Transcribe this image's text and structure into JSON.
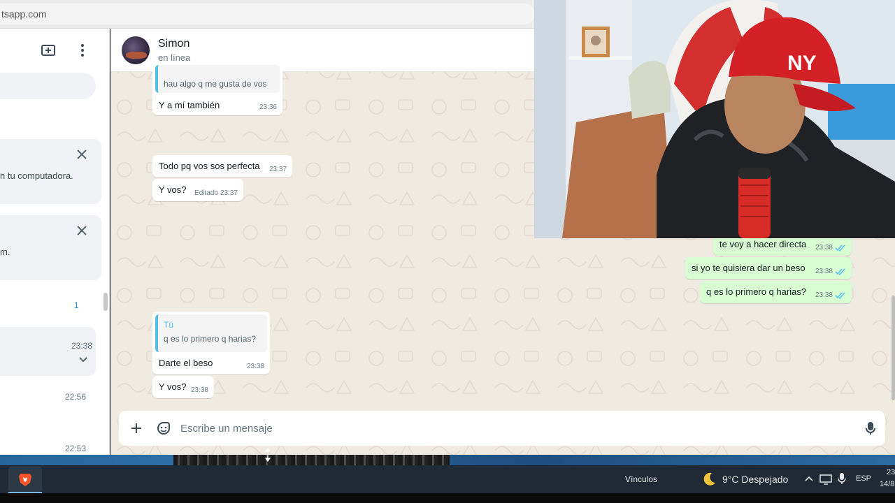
{
  "browser": {
    "url": "tsapp.com"
  },
  "sidebar": {
    "notices": [
      {
        "text": "n tu computadora."
      },
      {
        "text": "m."
      }
    ],
    "rows": [
      {
        "time": "",
        "badge": "1"
      },
      {
        "time": "23:38",
        "badge": ""
      },
      {
        "time": "22:56",
        "badge": ""
      },
      {
        "time": "22:53",
        "badge": ""
      }
    ]
  },
  "chat": {
    "contact_name": "Simon",
    "contact_status": "en línea",
    "messages": [
      {
        "dir": "in",
        "quote_text": "hau algo q me gusta de vos",
        "text": "Y a mí también",
        "time": "23:36"
      },
      {
        "dir": "in",
        "text": "Todo pq vos sos perfecta",
        "time": "23:37"
      },
      {
        "dir": "in",
        "text": "Y vos?",
        "edited": "Editado",
        "time": "23:37"
      },
      {
        "dir": "out",
        "text": "te voy a hacer directa",
        "time": "23:38"
      },
      {
        "dir": "out",
        "text": "si yo te quisiera dar un beso",
        "time": "23:38"
      },
      {
        "dir": "out",
        "text": "q es lo primero q harias?",
        "time": "23:38"
      },
      {
        "dir": "in",
        "quote_author": "Tú",
        "quote_text": "q es lo primero q harias?",
        "text": "Darte el beso",
        "time": "23:38"
      },
      {
        "dir": "in",
        "text": "Y vos?",
        "time": "23:38"
      }
    ],
    "composer_placeholder": "Escribe un mensaje"
  },
  "taskbar": {
    "links_label": "Vínculos",
    "weather": "9°C  Despejado",
    "language": "ESP",
    "clock_time": "23",
    "clock_date": "14/8"
  },
  "colors": {
    "incoming_bubble": "#ffffff",
    "outgoing_bubble": "#d9fdd3",
    "read_ticks": "#53bdeb",
    "chat_background": "#efeae2"
  },
  "icons": [
    "new-chat-icon",
    "menu-dots-icon",
    "close-icon",
    "chevron-down-icon",
    "plus-icon",
    "sticker-icon",
    "microphone-icon",
    "double-check-icon",
    "brave-icon",
    "moon-icon"
  ]
}
